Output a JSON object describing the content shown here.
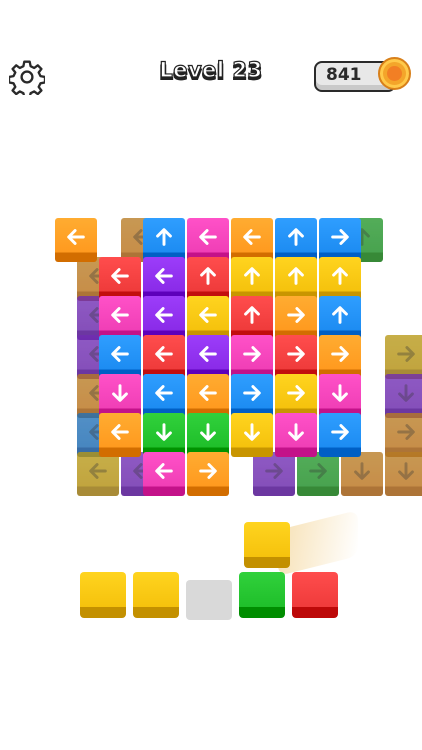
{
  "header": {
    "settings_icon": "gear-icon",
    "level_label": "Level 23",
    "coins": "841",
    "coin_icon": "coin-icon"
  },
  "colors": {
    "orange": "#ff9a1f",
    "blue": "#1d8cf2",
    "pink": "#f03fb6",
    "red": "#ef3b3b",
    "purple": "#8a2be8",
    "yellow": "#f5c20d",
    "green": "#1fbf2a",
    "empty": "#d9d9d9"
  },
  "board": {
    "tiles": [
      {
        "col": 0,
        "row": 0,
        "color": "orange",
        "dir": "left",
        "layer": "top"
      },
      {
        "col": 1,
        "row": 0,
        "color": "orange",
        "dir": "left",
        "layer": "shadow"
      },
      {
        "col": 2,
        "row": 0,
        "color": "blue",
        "dir": "up",
        "layer": "top"
      },
      {
        "col": 3,
        "row": 0,
        "color": "pink",
        "dir": "left",
        "layer": "top"
      },
      {
        "col": 4,
        "row": 0,
        "color": "orange",
        "dir": "left",
        "layer": "top"
      },
      {
        "col": 5,
        "row": 0,
        "color": "blue",
        "dir": "up",
        "layer": "top"
      },
      {
        "col": 6,
        "row": 0,
        "color": "green",
        "dir": "up",
        "layer": "shadow"
      },
      {
        "col": 6,
        "row": 0,
        "color": "blue",
        "dir": "right",
        "layer": "top"
      },
      {
        "col": 0,
        "row": 1,
        "color": "orange",
        "dir": "left",
        "layer": "shadow"
      },
      {
        "col": 1,
        "row": 1,
        "color": "red",
        "dir": "left",
        "layer": "top"
      },
      {
        "col": 2,
        "row": 1,
        "color": "purple",
        "dir": "left",
        "layer": "top"
      },
      {
        "col": 3,
        "row": 1,
        "color": "red",
        "dir": "up",
        "layer": "top"
      },
      {
        "col": 4,
        "row": 1,
        "color": "yellow",
        "dir": "up",
        "layer": "top"
      },
      {
        "col": 5,
        "row": 1,
        "color": "yellow",
        "dir": "up",
        "layer": "top"
      },
      {
        "col": 6,
        "row": 1,
        "color": "yellow",
        "dir": "up",
        "layer": "top"
      },
      {
        "col": 0,
        "row": 2,
        "color": "purple",
        "dir": "left",
        "layer": "shadow"
      },
      {
        "col": 1,
        "row": 2,
        "color": "pink",
        "dir": "left",
        "layer": "top"
      },
      {
        "col": 2,
        "row": 2,
        "color": "purple",
        "dir": "left",
        "layer": "top"
      },
      {
        "col": 3,
        "row": 2,
        "color": "yellow",
        "dir": "left",
        "layer": "top"
      },
      {
        "col": 4,
        "row": 2,
        "color": "red",
        "dir": "up",
        "layer": "top"
      },
      {
        "col": 5,
        "row": 2,
        "color": "orange",
        "dir": "right",
        "layer": "top"
      },
      {
        "col": 6,
        "row": 2,
        "color": "blue",
        "dir": "up",
        "layer": "top"
      },
      {
        "col": 0,
        "row": 3,
        "color": "purple",
        "dir": "left",
        "layer": "shadow"
      },
      {
        "col": 1,
        "row": 3,
        "color": "blue",
        "dir": "left",
        "layer": "top"
      },
      {
        "col": 2,
        "row": 3,
        "color": "red",
        "dir": "left",
        "layer": "top"
      },
      {
        "col": 3,
        "row": 3,
        "color": "purple",
        "dir": "left",
        "layer": "top"
      },
      {
        "col": 4,
        "row": 3,
        "color": "pink",
        "dir": "right",
        "layer": "top"
      },
      {
        "col": 5,
        "row": 3,
        "color": "red",
        "dir": "right",
        "layer": "top"
      },
      {
        "col": 6,
        "row": 3,
        "color": "orange",
        "dir": "right",
        "layer": "top"
      },
      {
        "col": 7,
        "row": 3,
        "color": "yellow",
        "dir": "right",
        "layer": "shadow"
      },
      {
        "col": 0,
        "row": 4,
        "color": "orange",
        "dir": "left",
        "layer": "shadow"
      },
      {
        "col": 1,
        "row": 4,
        "color": "pink",
        "dir": "down",
        "layer": "top"
      },
      {
        "col": 2,
        "row": 4,
        "color": "blue",
        "dir": "left",
        "layer": "top"
      },
      {
        "col": 3,
        "row": 4,
        "color": "orange",
        "dir": "left",
        "layer": "top"
      },
      {
        "col": 4,
        "row": 4,
        "color": "blue",
        "dir": "right",
        "layer": "top"
      },
      {
        "col": 5,
        "row": 4,
        "color": "yellow",
        "dir": "right",
        "layer": "top"
      },
      {
        "col": 6,
        "row": 4,
        "color": "pink",
        "dir": "down",
        "layer": "top"
      },
      {
        "col": 7,
        "row": 4,
        "color": "purple",
        "dir": "down",
        "layer": "shadow"
      },
      {
        "col": 0,
        "row": 5,
        "color": "blue",
        "dir": "left",
        "layer": "shadow"
      },
      {
        "col": 1,
        "row": 5,
        "color": "orange",
        "dir": "left",
        "layer": "top"
      },
      {
        "col": 2,
        "row": 5,
        "color": "green",
        "dir": "down",
        "layer": "top"
      },
      {
        "col": 3,
        "row": 5,
        "color": "green",
        "dir": "down",
        "layer": "top"
      },
      {
        "col": 4,
        "row": 5,
        "color": "yellow",
        "dir": "down",
        "layer": "top"
      },
      {
        "col": 5,
        "row": 5,
        "color": "pink",
        "dir": "down",
        "layer": "top"
      },
      {
        "col": 6,
        "row": 5,
        "color": "blue",
        "dir": "right",
        "layer": "top"
      },
      {
        "col": 7,
        "row": 5,
        "color": "orange",
        "dir": "right",
        "layer": "shadow"
      },
      {
        "col": 0,
        "row": 6,
        "color": "yellow",
        "dir": "left",
        "layer": "shadow"
      },
      {
        "col": 1,
        "row": 6,
        "color": "purple",
        "dir": "left",
        "layer": "shadow"
      },
      {
        "col": 2,
        "row": 6,
        "color": "pink",
        "dir": "left",
        "layer": "top"
      },
      {
        "col": 3,
        "row": 6,
        "color": "orange",
        "dir": "right",
        "layer": "top"
      },
      {
        "col": 4,
        "row": 6,
        "color": "purple",
        "dir": "right",
        "layer": "shadow"
      },
      {
        "col": 5,
        "row": 6,
        "color": "green",
        "dir": "right",
        "layer": "shadow"
      },
      {
        "col": 6,
        "row": 6,
        "color": "orange",
        "dir": "down",
        "layer": "shadow"
      },
      {
        "col": 7,
        "row": 6,
        "color": "orange",
        "dir": "down",
        "layer": "shadow"
      }
    ]
  },
  "tray": {
    "slots": [
      "yellow",
      "yellow",
      "empty",
      "green",
      "red"
    ]
  },
  "flying_tile": {
    "color": "yellow"
  }
}
